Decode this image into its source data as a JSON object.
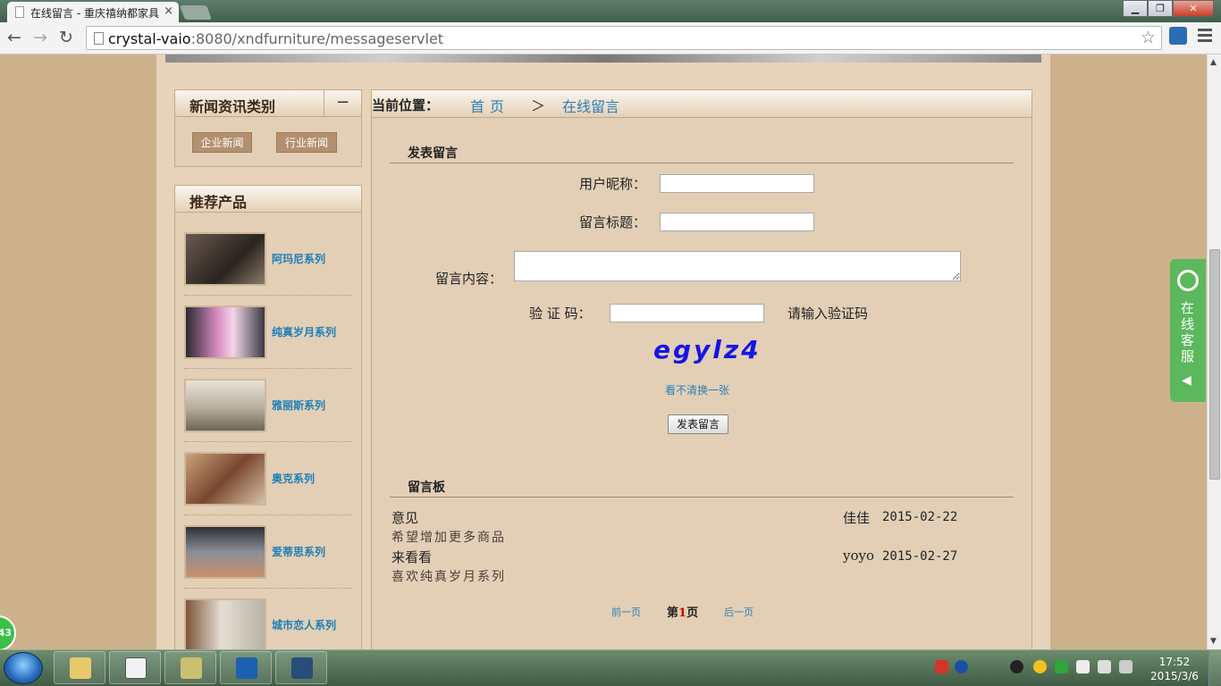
{
  "browser": {
    "tab_title": "在线留言 - 重庆禧纳都家具",
    "tab_close": "×",
    "window_controls": {
      "minimize": "▁",
      "maximize": "❐",
      "close": "✕"
    },
    "nav": {
      "back_icon": "←",
      "forward_icon": "→",
      "reload_icon": "↻",
      "star_icon": "☆"
    },
    "url_host": "crystal-vaio",
    "url_path": ":8080/xndfurniture/messageservlet"
  },
  "sidebar": {
    "news_title": "新闻资讯类别",
    "collapse_label": "−",
    "news_categories": [
      "企业新闻",
      "行业新闻"
    ],
    "products_title": "推荐产品",
    "products": [
      {
        "name": "阿玛尼系列",
        "color": "#4a3a30"
      },
      {
        "name": "纯真岁月系列",
        "color": "#b46a9a"
      },
      {
        "name": "雅丽斯系列",
        "color": "#c9c1b2"
      },
      {
        "name": "奥克系列",
        "color": "#8a5a40"
      },
      {
        "name": "爱蒂思系列",
        "color": "#6b6f78"
      },
      {
        "name": "城市恋人系列",
        "color": "#9b8b78"
      }
    ]
  },
  "breadcrumb": {
    "label": "当前位置：",
    "home": "首页",
    "separator": "＞",
    "current": "在线留言"
  },
  "form": {
    "section_title": "发表留言",
    "nickname_label": "用户昵称：",
    "nickname_value": "",
    "title_label": "留言标题：",
    "title_value": "",
    "content_label": "留言内容：",
    "content_value": "",
    "captcha_label": "验 证 码：",
    "captcha_value": "",
    "captcha_hint": "请输入验证码",
    "captcha_text": "egylz4",
    "refresh_link": "看不清换一张",
    "submit_label": "发表留言"
  },
  "board": {
    "section_title": "留言板",
    "messages": [
      {
        "title": "意见",
        "body": "希望增加更多商品",
        "user": "佳佳",
        "date": "2015-02-22"
      },
      {
        "title": "来看看",
        "body": "喜欢纯真岁月系列",
        "user": "yoyo",
        "date": "2015-02-27"
      }
    ],
    "pager": {
      "prev": "前一页",
      "current_prefix": "第",
      "current_page": "1",
      "current_suffix": "页",
      "next": "后一页"
    }
  },
  "widgets": {
    "online_service": "在线客服",
    "service_arrow": "◀",
    "badge": "43"
  },
  "taskbar": {
    "time": "17:52",
    "date": "2015/3/6"
  },
  "colors": {
    "link": "#2b7fb8",
    "page_bg": "#cdb08c",
    "panel_bg": "#e2cfb6",
    "captcha": "#1515e6",
    "service_green": "#5cb85c"
  }
}
